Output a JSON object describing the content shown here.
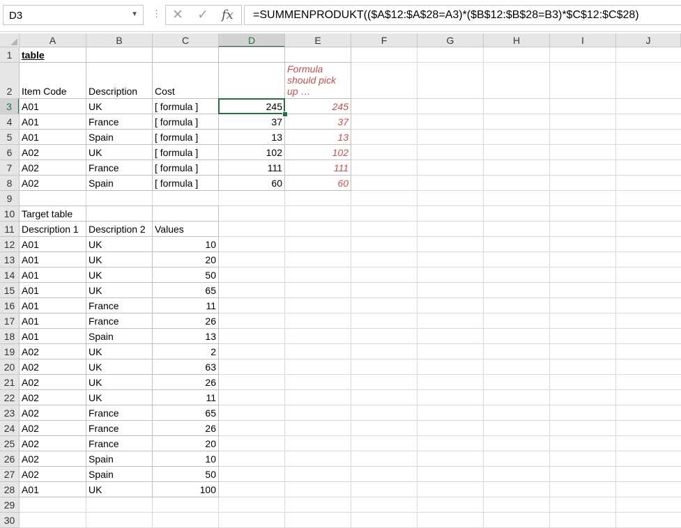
{
  "formula_bar": {
    "name_box": "D3",
    "formula": "=SUMMENPRODUKT(($A$12:$A$28=A3)*($B$12:$B$28=B3)*$C$12:$C$28)"
  },
  "columns": [
    "A",
    "B",
    "C",
    "D",
    "E",
    "F",
    "G",
    "H",
    "I",
    "J"
  ],
  "rows": [
    "1",
    "2",
    "3",
    "4",
    "5",
    "6",
    "7",
    "8",
    "9",
    "10",
    "11",
    "12",
    "13",
    "14",
    "15",
    "16",
    "17",
    "18",
    "19",
    "20",
    "21",
    "22",
    "23",
    "24",
    "25",
    "26",
    "27",
    "28",
    "29",
    "30"
  ],
  "selected_cell": "D3",
  "sheet": {
    "title": "table",
    "headers": [
      "Item Code",
      "Description",
      "Cost"
    ],
    "note": "Formula should pick up …",
    "rows": [
      {
        "code": "A01",
        "desc": "UK",
        "cost": "[ formula ]",
        "d": "245",
        "e": "245"
      },
      {
        "code": "A01",
        "desc": "France",
        "cost": "[ formula ]",
        "d": "37",
        "e": "37"
      },
      {
        "code": "A01",
        "desc": "Spain",
        "cost": "[ formula ]",
        "d": "13",
        "e": "13"
      },
      {
        "code": "A02",
        "desc": "UK",
        "cost": "[ formula ]",
        "d": "102",
        "e": "102"
      },
      {
        "code": "A02",
        "desc": "France",
        "cost": "[ formula ]",
        "d": "111",
        "e": "111"
      },
      {
        "code": "A02",
        "desc": "Spain",
        "cost": "[ formula ]",
        "d": "60",
        "e": "60"
      }
    ],
    "target_title": "Target table",
    "target_headers": [
      "Description 1",
      "Description 2",
      "Values"
    ],
    "target_rows": [
      {
        "d1": "A01",
        "d2": "UK",
        "v": "10"
      },
      {
        "d1": "A01",
        "d2": "UK",
        "v": "20"
      },
      {
        "d1": "A01",
        "d2": "UK",
        "v": "50"
      },
      {
        "d1": "A01",
        "d2": "UK",
        "v": "65"
      },
      {
        "d1": "A01",
        "d2": "France",
        "v": "11"
      },
      {
        "d1": "A01",
        "d2": "France",
        "v": "26"
      },
      {
        "d1": "A01",
        "d2": "Spain",
        "v": "13"
      },
      {
        "d1": "A02",
        "d2": "UK",
        "v": "2"
      },
      {
        "d1": "A02",
        "d2": "UK",
        "v": "63"
      },
      {
        "d1": "A02",
        "d2": "UK",
        "v": "26"
      },
      {
        "d1": "A02",
        "d2": "UK",
        "v": "11"
      },
      {
        "d1": "A02",
        "d2": "France",
        "v": "65"
      },
      {
        "d1": "A02",
        "d2": "France",
        "v": "26"
      },
      {
        "d1": "A02",
        "d2": "France",
        "v": "20"
      },
      {
        "d1": "A02",
        "d2": "Spain",
        "v": "10"
      },
      {
        "d1": "A02",
        "d2": "Spain",
        "v": "50"
      },
      {
        "d1": "A01",
        "d2": "UK",
        "v": "100"
      }
    ]
  },
  "colors": {
    "accent": "#217346",
    "note": "#c0504d"
  }
}
